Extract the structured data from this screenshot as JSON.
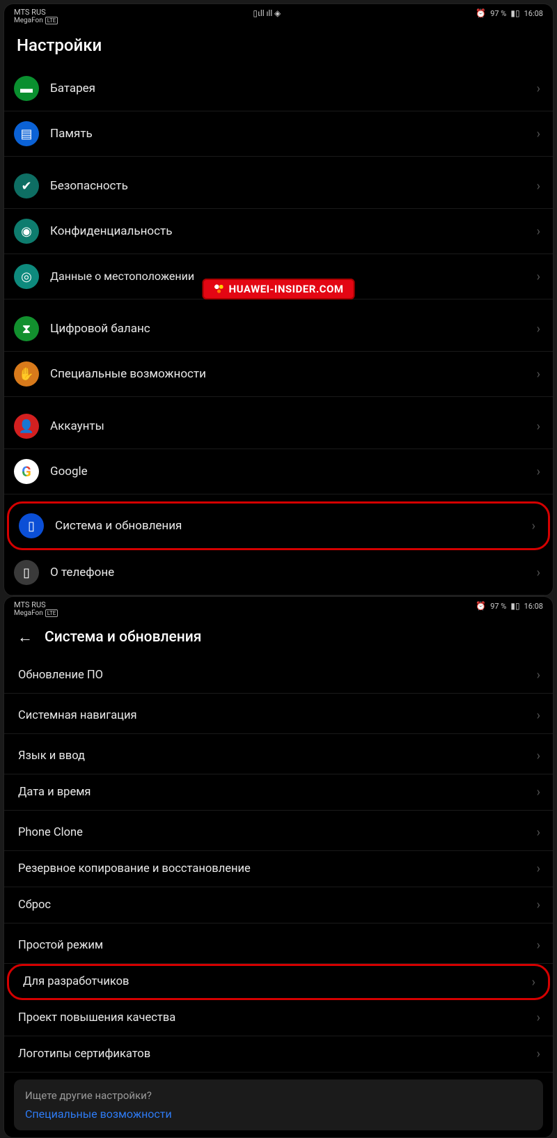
{
  "status": {
    "carrier": "MTS RUS",
    "subcarrier": "MegaFon",
    "lte": "LTE",
    "battery_pct": "97 %",
    "time": "16:08"
  },
  "left": {
    "title": "Настройки",
    "items": [
      {
        "label": "Батарея"
      },
      {
        "label": "Память"
      },
      {
        "label": "Безопасность"
      },
      {
        "label": "Конфиденциальность"
      },
      {
        "label": "Данные о местоположении"
      },
      {
        "label": "Цифровой баланс"
      },
      {
        "label": "Специальные возможности"
      },
      {
        "label": "Аккаунты"
      },
      {
        "label": "Google"
      },
      {
        "label": "Система и обновления"
      },
      {
        "label": "О телефоне"
      }
    ]
  },
  "right": {
    "title": "Система и обновления",
    "items": [
      {
        "label": "Обновление ПО"
      },
      {
        "label": "Системная навигация"
      },
      {
        "label": "Язык и ввод"
      },
      {
        "label": "Дата и время"
      },
      {
        "label": "Phone Clone"
      },
      {
        "label": "Резервное копирование и восстановление"
      },
      {
        "label": "Сброс"
      },
      {
        "label": "Простой режим"
      },
      {
        "label": "Для разработчиков"
      },
      {
        "label": "Проект повышения качества"
      },
      {
        "label": "Логотипы сертификатов"
      }
    ],
    "search": {
      "question": "Ищете другие настройки?",
      "link": "Специальные возможности"
    }
  },
  "watermark": "HUAWEI-INSIDER.COM"
}
